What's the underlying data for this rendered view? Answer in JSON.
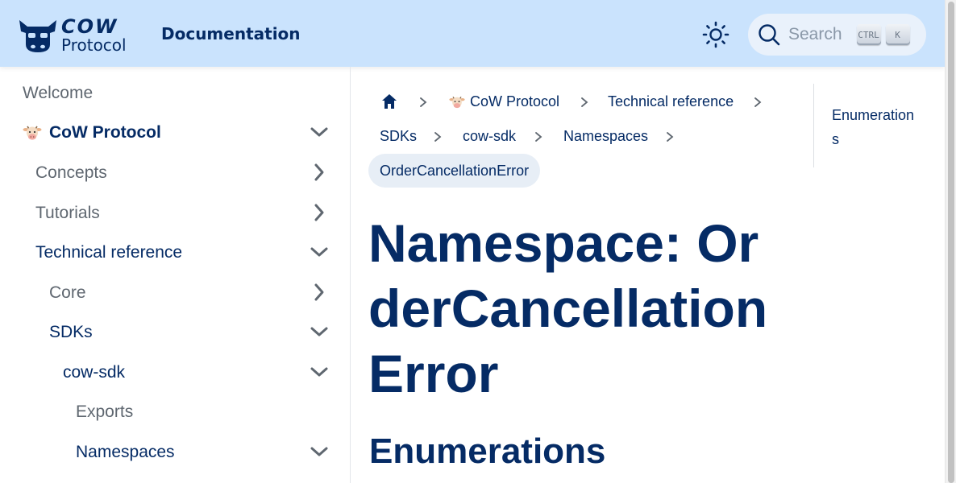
{
  "navbar": {
    "logo_word1": "COW",
    "logo_word2": "Protocol",
    "title": "Documentation",
    "search_label": "Search",
    "kbd_ctrl": "CTRL",
    "kbd_k": "K"
  },
  "sidebar": {
    "items": [
      {
        "label": "Welcome"
      },
      {
        "label": "CoW Protocol"
      },
      {
        "label": "Concepts"
      },
      {
        "label": "Tutorials"
      },
      {
        "label": "Technical reference"
      },
      {
        "label": "Core"
      },
      {
        "label": "SDKs"
      },
      {
        "label": "cow-sdk"
      },
      {
        "label": "Exports"
      },
      {
        "label": "Namespaces"
      }
    ]
  },
  "breadcrumbs": {
    "items": [
      "CoW Protocol",
      "Technical reference",
      "SDKs",
      "cow-sdk",
      "Namespaces"
    ],
    "current": "OrderCancellationError"
  },
  "main": {
    "title": "Namespace: OrderCancellationError",
    "section": "Enumerations"
  },
  "toc": {
    "items": [
      "Enumerations"
    ]
  },
  "colors": {
    "navbar_bg": "#cae3fd",
    "primary_text": "#052b65",
    "muted_text": "#5f6770"
  }
}
